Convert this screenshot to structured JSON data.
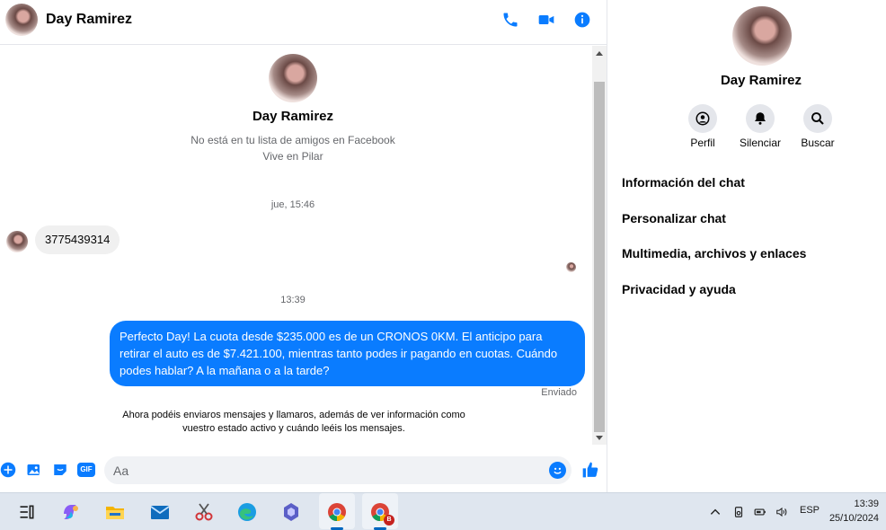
{
  "header": {
    "contact_name": "Day Ramirez",
    "icons": [
      "phone-icon",
      "video-icon",
      "info-icon"
    ],
    "accent": "#0a7cff"
  },
  "profile": {
    "name": "Day Ramirez",
    "friend_status": "No está en tu lista de amigos en Facebook",
    "location": "Vive en Pilar"
  },
  "messages": {
    "sep1": "jue, 15:46",
    "incoming_1": "3775439314",
    "sep2": "13:39",
    "outgoing_1": "Perfecto Day! La cuota desde $235.000 es de un CRONOS 0KM. El anticipo para retirar el auto es de $7.421.100, mientras tanto podes ir pagando en cuotas. Cuándo podes hablar? A la mañana o a la tarde?",
    "sent_status": "Enviado",
    "notice": "Ahora podéis enviaros mensajes y llamaros, además de ver información como vuestro estado activo y cuándo leéis los mensajes."
  },
  "composer": {
    "placeholder": "Aa",
    "gif_label": "GIF",
    "icons": [
      "plus-icon",
      "image-icon",
      "sticker-icon",
      "gif-icon",
      "emoji-icon",
      "like-icon"
    ]
  },
  "side": {
    "name": "Day Ramirez",
    "actions": [
      {
        "label": "Perfil",
        "icon": "profile-icon"
      },
      {
        "label": "Silenciar",
        "icon": "bell-icon"
      },
      {
        "label": "Buscar",
        "icon": "search-icon"
      }
    ],
    "items": [
      "Información del chat",
      "Personalizar chat",
      "Multimedia, archivos y enlaces",
      "Privacidad y ayuda"
    ]
  },
  "taskbar": {
    "language": "ESP",
    "time": "13:39",
    "date": "25/10/2024",
    "badge": "B",
    "apps": [
      "task-view-icon",
      "copilot-icon",
      "file-explorer-icon",
      "mail-icon",
      "snipping-tool-icon",
      "edge-icon",
      "copilot-app-icon",
      "chrome-icon",
      "chrome-profile-icon"
    ]
  }
}
